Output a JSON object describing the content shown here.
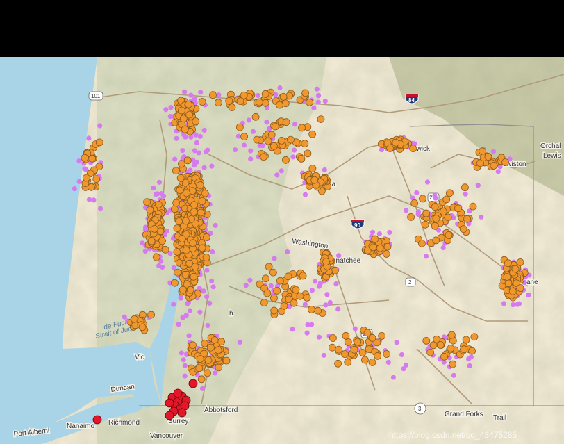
{
  "map": {
    "colors": {
      "ocean": "#a9d3e6",
      "land_west": "#d9dcc0",
      "land_east": "#efe8d3",
      "mountains": "#c7c8a6",
      "road": "#b09a7a",
      "border": "#8f8f8f",
      "orange_point": "#f0982e",
      "orange_stroke": "#8a5a1e",
      "violet_point": "#d67bef",
      "red_point": "#e2182a",
      "red_stroke": "#5a0008"
    },
    "icons": {
      "orange_point": "circle-marker",
      "violet_point": "circle-marker",
      "red_point": "circle-marker",
      "interstate_shield": "interstate-shield-icon",
      "highway_shield": "highway-shield-icon"
    },
    "labels": {
      "wenatchee": "enatchee",
      "washington": "Washington",
      "yakima": "kima",
      "kennewick": "ewick",
      "lewiston": "Lewiston",
      "orchard": "Orchal",
      "lewis": "Lewis",
      "spokane": "ane",
      "strait": "Strait of Juan",
      "de_fuca": "de Fuca",
      "duncan": "Duncan",
      "vic": "Vic",
      "richmond": "Richmond",
      "nanaimo": "Nanaimo",
      "port_alberni": "Port Alberni",
      "surrey": "Surrey",
      "vancouver": "Vancouver",
      "abbotsford": "Abbotsford",
      "grand_forks": "Grand Forks",
      "trail": "Trail",
      "olympia_frag": "h",
      "seattle_frag": "o"
    },
    "shields": {
      "i84": "84",
      "i90": "90",
      "us101": "101",
      "r3": "3",
      "r97": "97",
      "r26": "26",
      "r2": "2"
    },
    "watermark": "https://blog.csdn.net/qq_43475285"
  }
}
